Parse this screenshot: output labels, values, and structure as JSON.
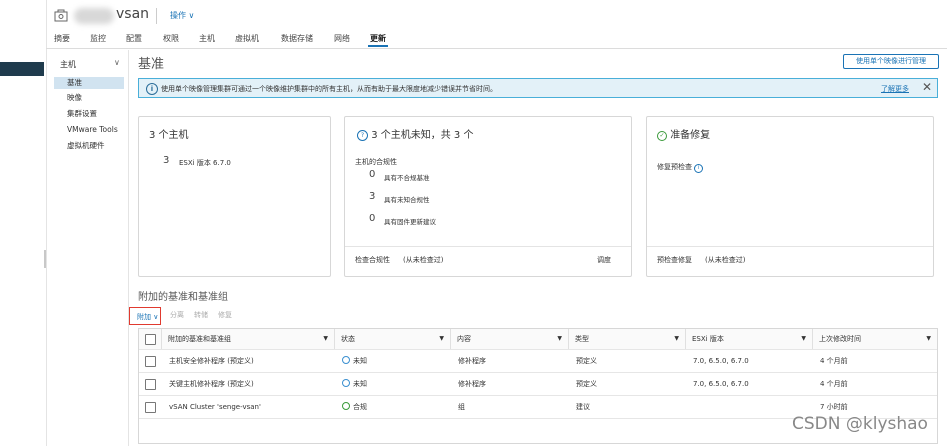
{
  "header": {
    "title": "vsan",
    "action_label": "操作 ∨",
    "tabs": [
      "摘要",
      "监控",
      "配置",
      "权限",
      "主机",
      "虚拟机",
      "数据存储",
      "网络",
      "更新"
    ],
    "active_tab": "更新"
  },
  "nav": {
    "head": "主机",
    "items": [
      "基准",
      "映像",
      "集群设置",
      "VMware Tools",
      "虚拟机硬件"
    ]
  },
  "main": {
    "title": "基准",
    "image_button": "使用单个映像进行管理",
    "banner": {
      "text": "使用单个映像管理集群可通过一个映像维护集群中的所有主机，从而有助于最大限度地减少错误并节省时间。",
      "more": "了解更多"
    },
    "card1": {
      "title": "3 个主机",
      "count": "3",
      "label": "ESXi 版本 6.7.0"
    },
    "card2": {
      "title": "3 个主机未知，共 3 个",
      "subtitle": "主机的合规性",
      "rows": [
        {
          "n": "0",
          "label": "具有不合规基准"
        },
        {
          "n": "3",
          "label": "具有未知合规性"
        },
        {
          "n": "0",
          "label": "具有固件更新建议"
        }
      ],
      "foot_link": "检查合规性",
      "foot_text": "(从未检查过)",
      "foot_right": "调度"
    },
    "card3": {
      "title": "准备修复",
      "subtitle": "修复预检查",
      "foot_link": "预检查修复",
      "foot_text": "(从未检查过)"
    },
    "section_title": "附加的基准和基准组",
    "toolbar": {
      "attach": "附加 ∨",
      "detach": "分离",
      "stage": "转储",
      "remediate": "修复"
    },
    "table": {
      "columns": [
        "附加的基准和基准组",
        "状态",
        "内容",
        "类型",
        "ESXi 版本",
        "上次修改时间"
      ],
      "rows": [
        {
          "name": "主机安全修补程序 (预定义)",
          "status": "未知",
          "content": "修补程序",
          "type": "预定义",
          "esxi": "7.0, 6.5.0, 6.7.0",
          "modified": "4 个月前"
        },
        {
          "name": "关键主机修补程序 (预定义)",
          "status": "未知",
          "content": "修补程序",
          "type": "预定义",
          "esxi": "7.0, 6.5.0, 6.7.0",
          "modified": "4 个月前"
        },
        {
          "name": "vSAN Cluster 'senge-vsan'",
          "status": "合规",
          "content": "组",
          "type": "建议",
          "esxi": "",
          "modified": "7 小时前"
        }
      ]
    }
  },
  "overlay": {
    "csdn": "CSDN @klyshao"
  },
  "colors": {
    "accent": "#1a73b5",
    "banner_bg": "#e3f1f8",
    "nav_selected": "#d1e3f0",
    "highlight_box": "#e03a2f"
  }
}
